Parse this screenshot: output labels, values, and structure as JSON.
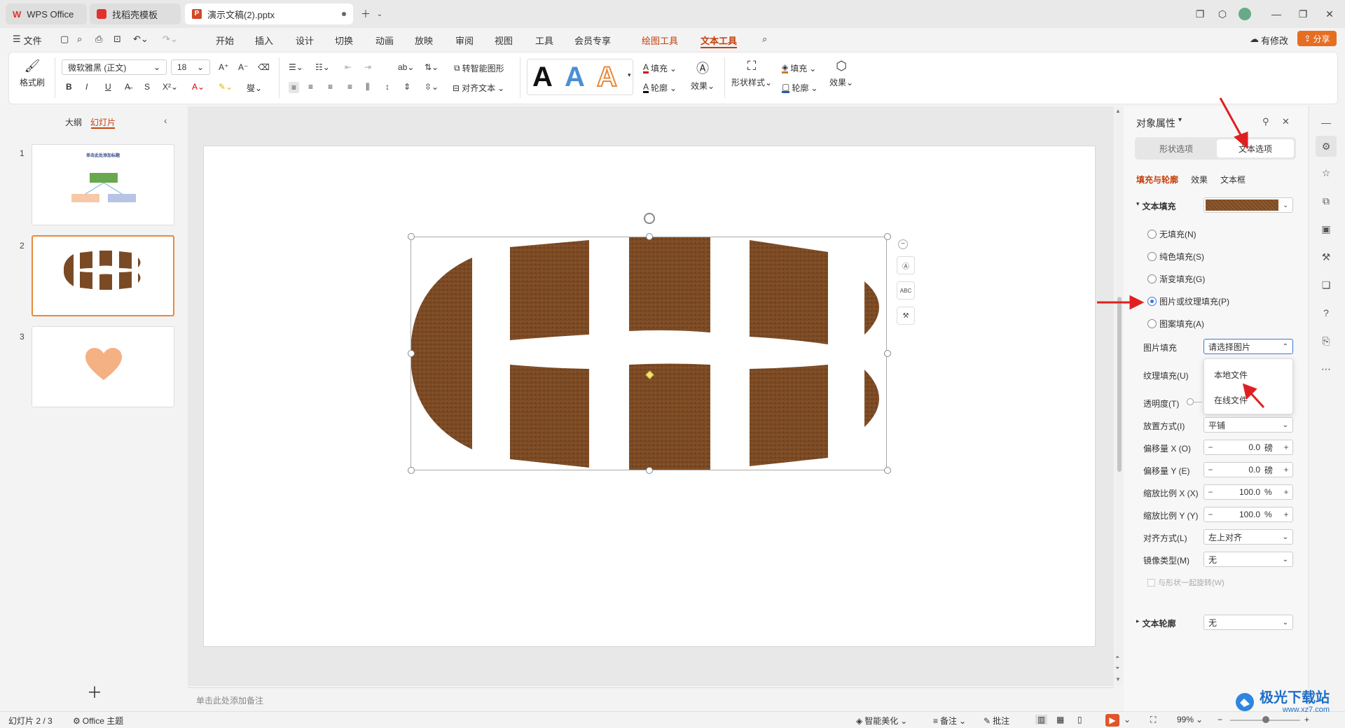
{
  "tabs": [
    {
      "label": "WPS Office",
      "icon": "wps-logo-icon"
    },
    {
      "label": "找稻壳模板",
      "icon": "docer-icon"
    },
    {
      "label": "演示文稿(2).pptx",
      "icon": "pptx-file-icon"
    }
  ],
  "menu": {
    "file": "文件",
    "items": [
      "开始",
      "插入",
      "设计",
      "切换",
      "动画",
      "放映",
      "审阅",
      "视图",
      "工具",
      "会员专享"
    ],
    "context_items": [
      "绘图工具",
      "文本工具"
    ],
    "modified": "有修改",
    "share": "分享"
  },
  "ribbon": {
    "format_painter": "格式刷",
    "font_name": "微软雅黑 (正文)",
    "font_size": "18",
    "smart_shape": "转智能图形",
    "align_text": "对齐文本",
    "fill": "填充",
    "outline": "轮廓",
    "effect": "效果",
    "shape_style": "形状样式",
    "shape_fill": "填充",
    "shape_outline": "轮廓",
    "shape_effect": "效果",
    "text_style_letter": "A"
  },
  "left_pane": {
    "tab_outline": "大纲",
    "tab_slides": "幻灯片",
    "slides": [
      {
        "num": "1",
        "title": "单击此处添加标题"
      },
      {
        "num": "2"
      },
      {
        "num": "3"
      }
    ]
  },
  "notes_placeholder": "单击此处添加备注",
  "panel": {
    "title": "对象属性",
    "tab_shape": "形状选项",
    "tab_text": "文本选项",
    "sub_fill": "填充与轮廓",
    "sub_effect": "效果",
    "sub_textbox": "文本框",
    "text_fill": "文本填充",
    "options": [
      "无填充(N)",
      "纯色填充(S)",
      "渐变填充(G)",
      "图片或纹理填充(P)",
      "图案填充(A)"
    ],
    "selected_option": "图片或纹理填充(P)",
    "picture_fill_label": "图片填充",
    "picture_fill_value": "请选择图片",
    "dropdown_items": [
      "本地文件",
      "在线文件"
    ],
    "texture_fill_label": "纹理填充(U)",
    "transparency_label": "透明度(T)",
    "placement_label": "放置方式(I)",
    "placement_value": "平铺",
    "offset_x_label": "偏移量 X (O)",
    "offset_x_value": "0.0",
    "offset_y_label": "偏移量 Y (E)",
    "offset_y_value": "0.0",
    "offset_unit": "磅",
    "scale_x_label": "缩放比例 X (X)",
    "scale_x_value": "100.0",
    "scale_y_label": "缩放比例 Y (Y)",
    "scale_y_value": "100.0",
    "scale_unit": "%",
    "align_label": "对齐方式(L)",
    "align_value": "左上对齐",
    "mirror_label": "镜像类型(M)",
    "mirror_value": "无",
    "rotate_with_shape": "与形状一起旋转(W)",
    "text_outline": "文本轮廓",
    "text_outline_value": "无"
  },
  "status": {
    "slide_info": "幻灯片 2 / 3",
    "theme": "Office 主题",
    "smart_beautify": "智能美化",
    "notes": "备注",
    "comments": "批注",
    "zoom": "99%"
  },
  "watermark": {
    "brand": "极光下载站",
    "url": "www.xz7.com"
  },
  "colors": {
    "accent": "#c4410d",
    "leather": "#7a4a25",
    "selection_blue": "#3a78d4",
    "arrow_red": "#e02020"
  }
}
